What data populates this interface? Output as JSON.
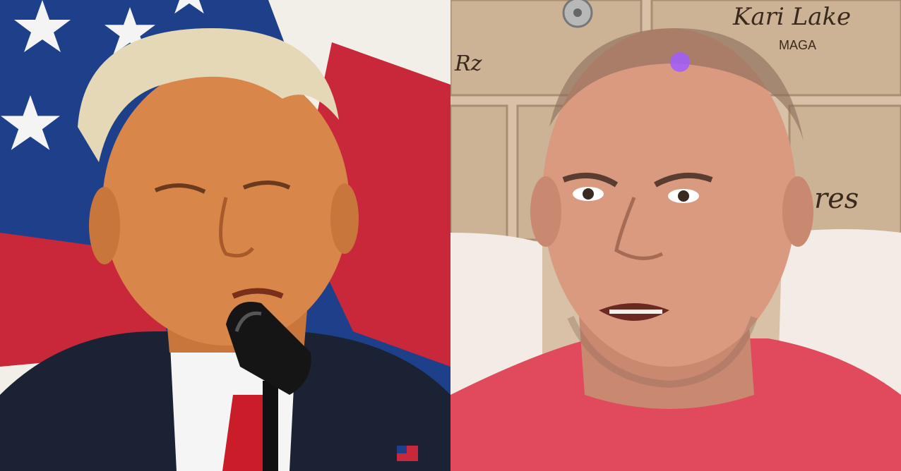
{
  "panels": {
    "left": {
      "subject": "speaker-at-microphone",
      "colors": {
        "flag_blue": "#1e3f8a",
        "flag_red": "#c8283a",
        "flag_white": "#f2efe9",
        "suit": "#1a2233",
        "tie": "#c91e2a",
        "skin": "#d9864a",
        "hair": "#e4d8b6"
      }
    },
    "right": {
      "subject": "man-in-red-shirt",
      "wall_text": {
        "signature_top": "Kari Lake",
        "caption_top": "MAGA",
        "scribble_left": "Rz",
        "scribble_right": "res"
      },
      "colors": {
        "wall": "#d8c1a6",
        "cabinet": "#cdb396",
        "chair": "#f3ece6",
        "shirt": "#e04a5c",
        "skin": "#d99a80",
        "glow": "#a05cff"
      }
    }
  }
}
